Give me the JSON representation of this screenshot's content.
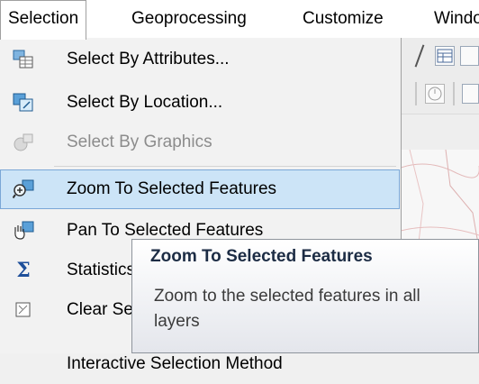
{
  "menubar": {
    "items": [
      {
        "label": "Selection",
        "active": true
      },
      {
        "label": "Geoprocessing"
      },
      {
        "label": "Customize"
      },
      {
        "label": "Windo"
      }
    ]
  },
  "menu": {
    "items": [
      {
        "label": "Select By Attributes...",
        "icon": "select-by-attributes-icon",
        "enabled": true
      },
      {
        "label": "Select By Location...",
        "icon": "select-by-location-icon",
        "enabled": true
      },
      {
        "label": "Select By Graphics",
        "icon": "select-by-graphics-icon",
        "enabled": false
      },
      {
        "label": "Zoom To Selected Features",
        "icon": "zoom-to-selected-icon",
        "enabled": true,
        "highlighted": true
      },
      {
        "label": "Pan To Selected Features",
        "icon": "pan-to-selected-icon",
        "enabled": true
      },
      {
        "label": "Statistics...",
        "icon": "sigma-icon",
        "enabled": true
      },
      {
        "label": "Clear Selected Features",
        "icon": "clear-selection-icon",
        "enabled": true
      },
      {
        "label": "Interactive Selection Method",
        "icon": "",
        "enabled": true
      }
    ]
  },
  "tooltip": {
    "title": "Zoom To Selected Features",
    "body": "Zoom to the selected features in all layers"
  },
  "colors": {
    "highlight_bg": "#cce4f7",
    "highlight_border": "#7aa7d6",
    "disabled_text": "#8c8c8c"
  }
}
